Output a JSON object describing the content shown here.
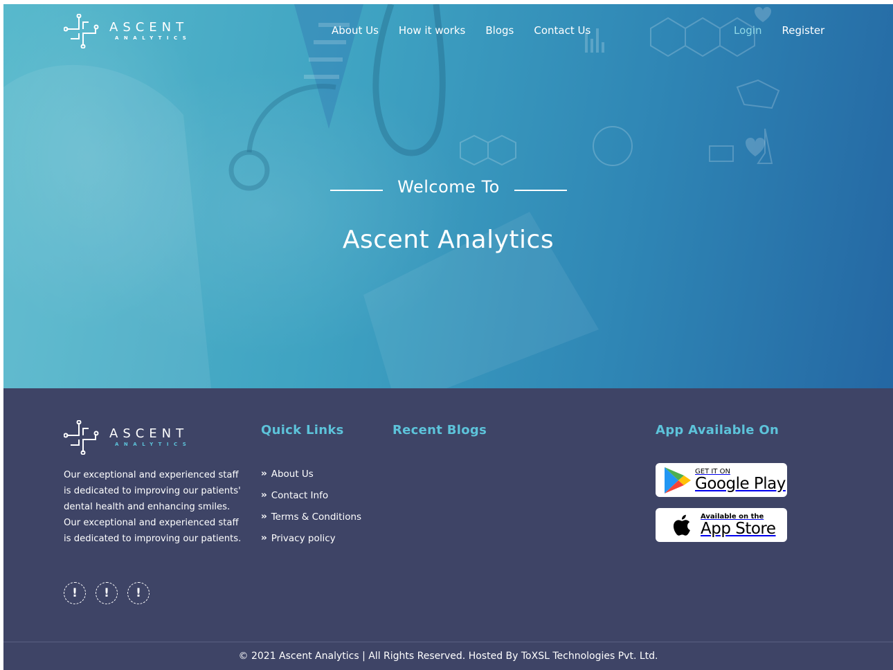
{
  "brand": {
    "name": "ASCENT",
    "tagline": "ANALYTICS",
    "logo_color": "#ffffff",
    "footer_accent": "#5dc3da"
  },
  "nav": {
    "items": [
      {
        "label": "About Us"
      },
      {
        "label": "How it works"
      },
      {
        "label": "Blogs"
      },
      {
        "label": "Contact Us"
      }
    ],
    "login": "Login",
    "register": "Register"
  },
  "hero": {
    "welcome": "Welcome To",
    "title": "Ascent Analytics"
  },
  "footer": {
    "description": "Our exceptional and experienced staff is dedicated to improving our patients' dental health and enhancing smiles. Our exceptional and experienced staff is dedicated to improving our patients.",
    "socials": [
      {
        "icon": "warning-icon",
        "glyph": "!"
      },
      {
        "icon": "warning-icon",
        "glyph": "!"
      },
      {
        "icon": "warning-icon",
        "glyph": "!"
      }
    ],
    "quick_links_title": "Quick Links",
    "quick_links": [
      {
        "label": "About Us"
      },
      {
        "label": "Contact Info"
      },
      {
        "label": "Terms & Conditions"
      },
      {
        "label": "Privacy policy"
      }
    ],
    "recent_blogs_title": "Recent Blogs",
    "app_title": "App Available On",
    "google_play": {
      "small": "GET IT ON",
      "big": "Google Play"
    },
    "app_store": {
      "small": "Available on the",
      "big": "App Store"
    },
    "copyright": "© 2021 Ascent Analytics | All Rights Reserved. Hosted By ToXSL Technologies Pvt. Ltd."
  },
  "colors": {
    "hero_start": "#58b9cc",
    "hero_end": "#2467a3",
    "footer_bg": "#3e4466",
    "login": "#8fd8e6"
  }
}
